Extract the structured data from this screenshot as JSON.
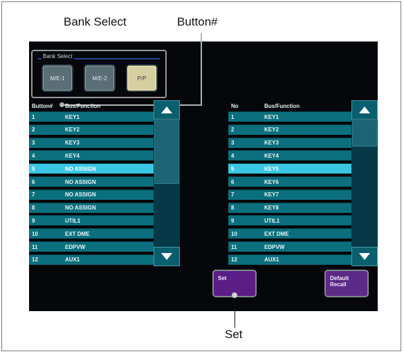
{
  "callouts": {
    "bank_select": "Bank Select",
    "button_num": "Button#",
    "set": "Set"
  },
  "bank_select": {
    "title": "Bank Select",
    "buttons": [
      {
        "label": "M/E-1"
      },
      {
        "label": "M/E-2"
      },
      {
        "label": "P/P",
        "selected": true
      }
    ]
  },
  "left_list": {
    "header": {
      "col1": "Button#",
      "col2": "Bus/Function"
    },
    "selected_index": 4,
    "rows": [
      {
        "no": "1",
        "fn": "KEY1"
      },
      {
        "no": "2",
        "fn": "KEY2"
      },
      {
        "no": "3",
        "fn": "KEY3"
      },
      {
        "no": "4",
        "fn": "KEY4"
      },
      {
        "no": "5",
        "fn": "NO ASSIGN"
      },
      {
        "no": "6",
        "fn": "NO ASSIGN"
      },
      {
        "no": "7",
        "fn": "NO ASSIGN"
      },
      {
        "no": "8",
        "fn": "NO ASSIGN"
      },
      {
        "no": "9",
        "fn": "UTIL1"
      },
      {
        "no": "10",
        "fn": "EXT DME"
      },
      {
        "no": "11",
        "fn": "EDPVW"
      },
      {
        "no": "12",
        "fn": "AUX1"
      }
    ]
  },
  "right_list": {
    "header": {
      "col1": "No",
      "col2": "Bus/Function"
    },
    "selected_index": 4,
    "rows": [
      {
        "no": "1",
        "fn": "KEY1"
      },
      {
        "no": "2",
        "fn": "KEY2"
      },
      {
        "no": "3",
        "fn": "KEY3"
      },
      {
        "no": "4",
        "fn": "KEY4"
      },
      {
        "no": "5",
        "fn": "KEY5"
      },
      {
        "no": "6",
        "fn": "KEY6"
      },
      {
        "no": "7",
        "fn": "KEY7"
      },
      {
        "no": "8",
        "fn": "KEY8"
      },
      {
        "no": "9",
        "fn": "UTIL1"
      },
      {
        "no": "10",
        "fn": "EXT DME"
      },
      {
        "no": "11",
        "fn": "EDPVW"
      },
      {
        "no": "12",
        "fn": "AUX1"
      }
    ]
  },
  "actions": {
    "set_label": "Set",
    "default_recall_label": "Default Recall"
  },
  "colors": {
    "screen_bg": "#06070a",
    "row_bg": "#0b6f7d",
    "row_selected": "#39c6e3",
    "button_purple": "#5b2a86",
    "pp_selected": "#d6cfa0"
  },
  "icons": {
    "scroll_up": "triangle-up-icon",
    "scroll_down": "triangle-down-icon"
  }
}
